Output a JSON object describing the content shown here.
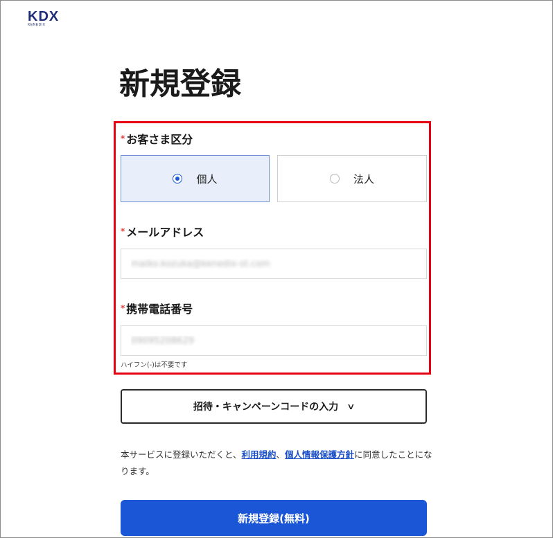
{
  "logo": {
    "main": "KDX",
    "sub": "KENEDIX"
  },
  "page_title": "新規登録",
  "customer_type": {
    "required_mark": "*",
    "label": "お客さま区分",
    "options": [
      {
        "label": "個人",
        "selected": true
      },
      {
        "label": "法人",
        "selected": false
      }
    ]
  },
  "email": {
    "required_mark": "*",
    "label": "メールアドレス",
    "value": "maiko.kozuka@kenedix-st.com"
  },
  "phone": {
    "required_mark": "*",
    "label": "携帯電話番号",
    "value": "09095208629",
    "hint": "ハイフン(-)は不要です"
  },
  "invite_code": {
    "label": "招待・キャンペーンコードの入力"
  },
  "agreement": {
    "prefix": "本サービスに登録いただくと、",
    "terms_link": "利用規約",
    "separator": "、",
    "privacy_link": "個人情報保護方針",
    "suffix": "に同意したことになります。"
  },
  "submit_label": "新規登録(無料)",
  "colors": {
    "accent": "#1a56d6",
    "highlight_border": "#e60012",
    "required": "#e0403a",
    "logo": "#1f2d78"
  }
}
